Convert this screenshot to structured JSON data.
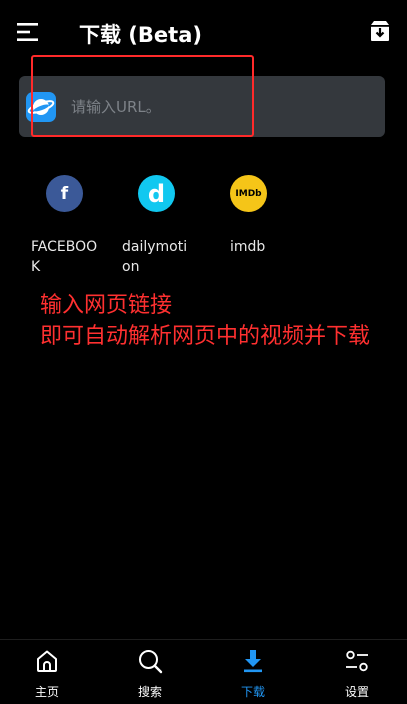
{
  "header": {
    "title": "下载 (Beta)"
  },
  "url_bar": {
    "placeholder": "请输入URL。"
  },
  "sites": [
    {
      "label": "FACEBOOK",
      "icon": "facebook-icon",
      "glyph": "f",
      "bg": "#3b5998",
      "fg": "#ffffff"
    },
    {
      "label": "dailymotion",
      "icon": "dailymotion-icon",
      "glyph": "d",
      "bg": "#11c8f0",
      "fg": "#ffffff"
    },
    {
      "label": "imdb",
      "icon": "imdb-icon",
      "glyph": "IMDb",
      "bg": "#f5c518",
      "fg": "#000000"
    }
  ],
  "annotation": "输入网页链接\n即可自动解析网页中的视频并下载",
  "nav": [
    {
      "label": "主页",
      "icon": "home-icon"
    },
    {
      "label": "搜索",
      "icon": "search-icon"
    },
    {
      "label": "下载",
      "icon": "download-icon",
      "active": true
    },
    {
      "label": "设置",
      "icon": "settings-icon"
    }
  ],
  "colors": {
    "accent": "#2196f3",
    "annotation": "#ff3030",
    "background": "#000000",
    "url_bar": "#34383d"
  }
}
